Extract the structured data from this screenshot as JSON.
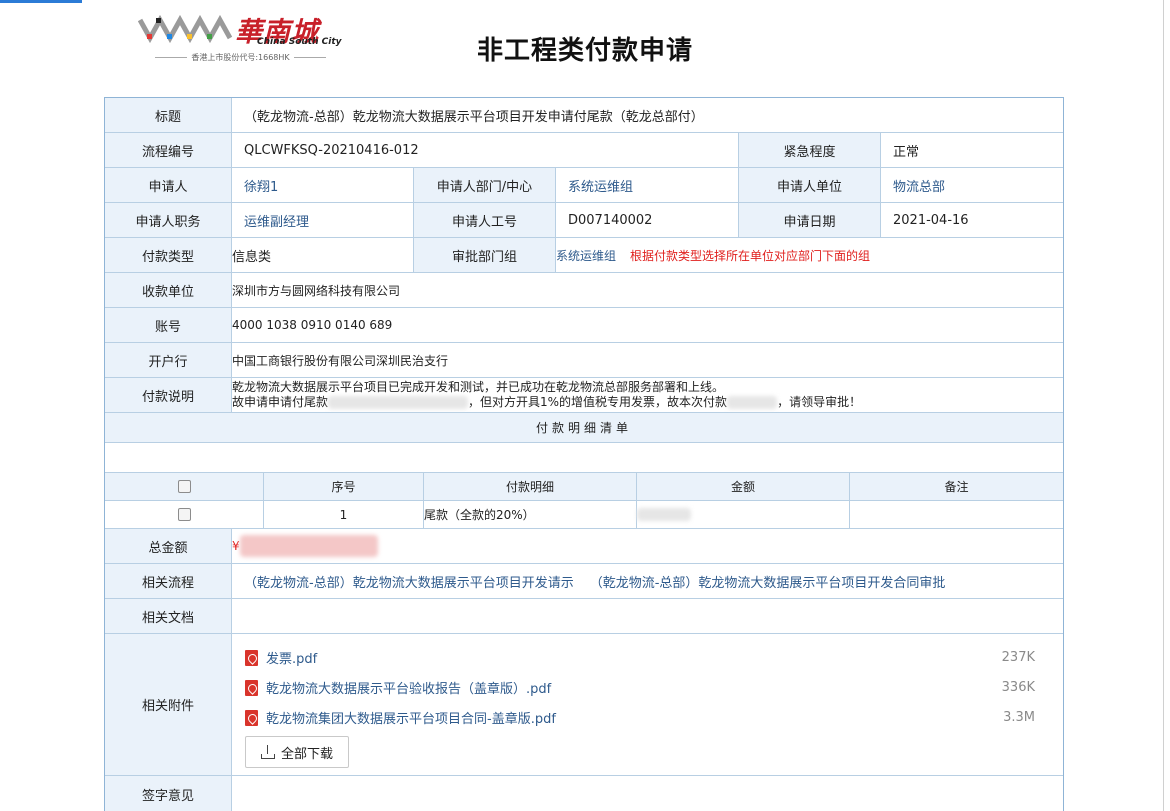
{
  "logo": {
    "cn": "華南城",
    "en": "China South City",
    "sub": "香港上市股份代号:1668HK"
  },
  "page_title": "非工程类付款申请",
  "colors": {
    "accent_link": "#2e5a8c",
    "label_bg": "#eaf2fa",
    "warning": "#e0201e",
    "pdf": "#d9342b"
  },
  "fields": {
    "title_label": "标题",
    "title_value": "（乾龙物流-总部）乾龙物流大数据展示平台项目开发申请付尾款（乾龙总部付）",
    "flow_no_label": "流程编号",
    "flow_no_value": "QLCWFKSQ-20210416-012",
    "urgency_label": "紧急程度",
    "urgency_value": "正常",
    "applicant_label": "申请人",
    "applicant_value": "徐翔1",
    "dept_label": "申请人部门/中心",
    "dept_value": "系统运维组",
    "unit_label": "申请人单位",
    "unit_value": "物流总部",
    "position_label": "申请人职务",
    "position_value": "运维副经理",
    "emp_no_label": "申请人工号",
    "emp_no_value": "D007140002",
    "date_label": "申请日期",
    "date_value": "2021-04-16",
    "pay_type_label": "付款类型",
    "pay_type_value": "信息类",
    "approve_dept_label": "审批部门组",
    "approve_dept_value": "系统运维组",
    "approve_dept_hint": "根据付款类型选择所在单位对应部门下面的组",
    "payee_label": "收款单位",
    "payee_value": "深圳市方与圆网络科技有限公司",
    "account_label": "账号",
    "account_value": "4000 1038 0910 0140 689",
    "bank_label": "开户行",
    "bank_value": "中国工商银行股份有限公司深圳民治支行",
    "desc_label": "付款说明",
    "desc_line1": "乾龙物流大数据展示平台项目已完成开发和测试，并已成功在乾龙物流总部服务部署和上线。",
    "desc_line2a": "故申请申请付尾款",
    "desc_line2b": "，但对方开具1%的增值税专用发票，故本次付款",
    "desc_line2c": "，请领导审批！"
  },
  "detail": {
    "section_title": "付款明细清单",
    "columns": [
      "序号",
      "付款明细",
      "金额",
      "备注"
    ],
    "rows": [
      {
        "no": "1",
        "item": "尾款（全款的20%）",
        "amount": "",
        "note": ""
      }
    ]
  },
  "total": {
    "label": "总金额",
    "prefix": "¥"
  },
  "related_flows": {
    "label": "相关流程",
    "items": [
      "（乾龙物流-总部）乾龙物流大数据展示平台项目开发请示",
      "（乾龙物流-总部）乾龙物流大数据展示平台项目开发合同审批"
    ]
  },
  "related_docs": {
    "label": "相关文档"
  },
  "attachments": {
    "label": "相关附件",
    "files": [
      {
        "name": "发票.pdf",
        "size": "237K",
        "icon": "pdf-icon"
      },
      {
        "name": "乾龙物流大数据展示平台验收报告（盖章版）.pdf",
        "size": "336K",
        "icon": "pdf-icon"
      },
      {
        "name": "乾龙物流集团大数据展示平台项目合同-盖章版.pdf",
        "size": "3.3M",
        "icon": "pdf-icon"
      }
    ],
    "download_all": "全部下载"
  },
  "sign": {
    "label": "签字意见"
  }
}
